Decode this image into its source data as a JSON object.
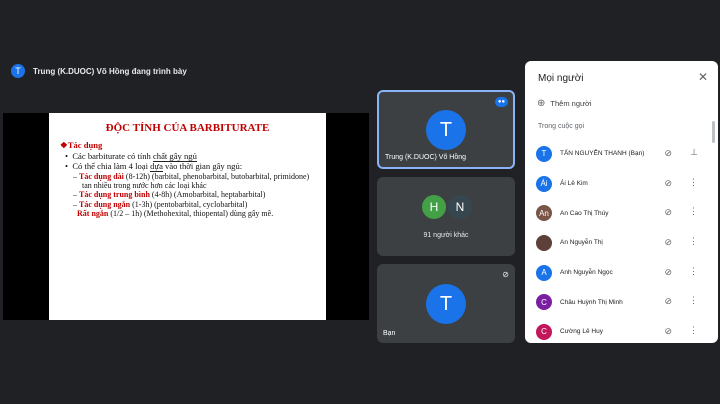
{
  "presenter_bar": {
    "avatar_letter": "T",
    "text": "Trung (K.DUOC) Võ Hồng đang trình bày"
  },
  "slide": {
    "title": "ĐỘC TÍNH CỦA BARBITURATE",
    "heading": "❖Tác dụng",
    "bullet1_pre": "Các barbiturate có tính ",
    "bullet1_u": "chất gây ngủ",
    "bullet2_pre": "Có thể chia làm 4 loại ",
    "bullet2_u": "dựa",
    "bullet2_post": " vào thời gian gây ngủ:",
    "items": [
      {
        "label": "Tác dụng dài",
        "text": " (8-12h) (barbital, phenobarbital, butobarbital, primidone) tan nhiều trong nước hơn các loại khác"
      },
      {
        "label": "Tác dụng trung bình",
        "text": " (4-8h) (Amobarbital, heptabarbital)"
      },
      {
        "label": "Tác dụng ngắn",
        "text": " (1-3h) (pentobarbital, cyclobarbital)"
      },
      {
        "label": "Rất ngắn",
        "text": " (1/2 – 1h) (Methohexital, thiopental) dùng gây mê."
      }
    ]
  },
  "tiles": {
    "presenter": {
      "letter": "T",
      "name": "Trung (K.DUOC) Võ Hồng"
    },
    "others": {
      "letters": [
        "H",
        "N"
      ],
      "label": "91 người khác"
    },
    "self": {
      "letter": "T",
      "name": "Bạn"
    }
  },
  "panel": {
    "title": "Mọi người",
    "add_label": "Thêm người",
    "section": "Trong cuộc gọi",
    "participants": [
      {
        "initial": "T",
        "name": "TẤN NGUYỄN THANH (Bạn)",
        "color": "#1a73e8",
        "action": "pin"
      },
      {
        "initial": "Ái",
        "name": "Ái Lê Kim",
        "color": "#1a73e8",
        "action": "more"
      },
      {
        "initial": "An",
        "name": "An Cao Thị Thúy",
        "color": "#795548",
        "action": "more"
      },
      {
        "initial": "",
        "name": "An Nguyễn Thị",
        "color": "#5d4037",
        "action": "more"
      },
      {
        "initial": "A",
        "name": "Anh Nguyễn Ngọc",
        "color": "#1a73e8",
        "action": "more"
      },
      {
        "initial": "C",
        "name": "Châu Huỳnh Thị Minh",
        "color": "#7b1fa2",
        "action": "more"
      },
      {
        "initial": "C",
        "name": "Cường Lê Huy",
        "color": "#c2185b",
        "action": "more"
      }
    ]
  },
  "icons": {
    "mic_off": "mic-off-icon",
    "more": "more-vert-icon",
    "pin": "pin-icon",
    "close": "close-icon",
    "add_person": "person-add-icon"
  }
}
